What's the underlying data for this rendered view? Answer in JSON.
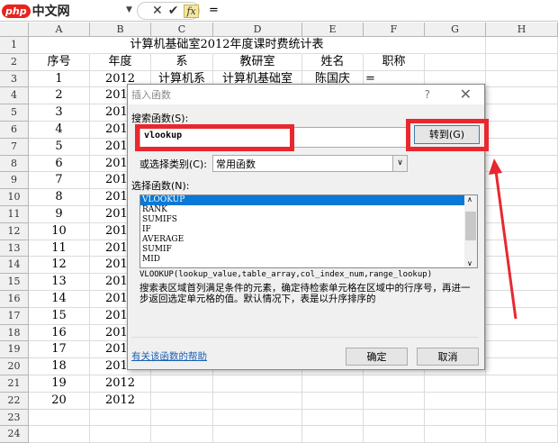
{
  "watermark": "php中文网",
  "formula_bar": {
    "cancel": "✕",
    "enter": "✔",
    "fx": "fx",
    "formula": "="
  },
  "columns": [
    "A",
    "B",
    "C",
    "D",
    "E",
    "F",
    "G",
    "H"
  ],
  "sheet_title": "计算机基础室2012年度课时费统计表",
  "headers": [
    "序号",
    "年度",
    "系",
    "教研室",
    "姓名",
    "职称"
  ],
  "row3": {
    "C": "计算机系",
    "D": "计算机基础室",
    "E": "陈国庆",
    "F": "="
  },
  "year": "2012",
  "row_numbers": [
    "1",
    "2",
    "3",
    "4",
    "5",
    "6",
    "7",
    "8",
    "9",
    "10",
    "11",
    "12",
    "13",
    "14",
    "15",
    "16",
    "17",
    "18",
    "19",
    "20",
    "21",
    "22",
    "23",
    "24"
  ],
  "seq": [
    "1",
    "2",
    "3",
    "4",
    "5",
    "6",
    "7",
    "8",
    "9",
    "10",
    "11",
    "12",
    "13",
    "14",
    "15",
    "16",
    "17",
    "18",
    "19",
    "20"
  ],
  "dialog": {
    "title": "插入函数",
    "help_q": "?",
    "close": "✕",
    "search_label": "搜索函数(S):",
    "search_value": "vlookup",
    "go": "转到(G)",
    "category_label": "或选择类别(C):",
    "category_value": "常用函数",
    "select_label": "选择函数(N):",
    "functions": [
      "VLOOKUP",
      "RANK",
      "SUMIFS",
      "IF",
      "AVERAGE",
      "SUMIF",
      "MID"
    ],
    "signature": "VLOOKUP(lookup_value,table_array,col_index_num,range_lookup)",
    "description": "搜索表区域首列满足条件的元素，确定待检索单元格在区域中的行序号，再进一步返回选定单元格的值。默认情况下，表是以升序排序的",
    "help_link": "有关该函数的帮助",
    "ok": "确定",
    "cancel": "取消"
  },
  "annotation_color": "#e8282e"
}
